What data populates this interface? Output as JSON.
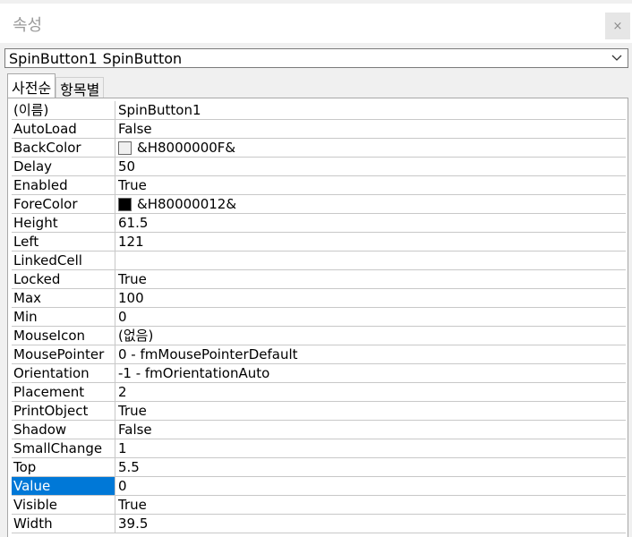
{
  "window": {
    "title": "속성",
    "close_glyph": "×"
  },
  "object_selector": {
    "name": "SpinButton1",
    "type": "SpinButton"
  },
  "tabs": [
    {
      "label": "사전순",
      "active": true
    },
    {
      "label": "항목별",
      "active": false
    }
  ],
  "properties": [
    {
      "name": "(이름)",
      "value": "SpinButton1"
    },
    {
      "name": "AutoLoad",
      "value": "False"
    },
    {
      "name": "BackColor",
      "value": "&H8000000F&",
      "swatch": "#f0f0f0"
    },
    {
      "name": "Delay",
      "value": "50"
    },
    {
      "name": "Enabled",
      "value": "True"
    },
    {
      "name": "ForeColor",
      "value": "&H80000012&",
      "swatch": "#000000"
    },
    {
      "name": "Height",
      "value": "61.5"
    },
    {
      "name": "Left",
      "value": "121"
    },
    {
      "name": "LinkedCell",
      "value": ""
    },
    {
      "name": "Locked",
      "value": "True"
    },
    {
      "name": "Max",
      "value": "100"
    },
    {
      "name": "Min",
      "value": "0"
    },
    {
      "name": "MouseIcon",
      "value": "(없음)"
    },
    {
      "name": "MousePointer",
      "value": "0 - fmMousePointerDefault"
    },
    {
      "name": "Orientation",
      "value": "-1 - fmOrientationAuto"
    },
    {
      "name": "Placement",
      "value": "2"
    },
    {
      "name": "PrintObject",
      "value": "True"
    },
    {
      "name": "Shadow",
      "value": "False"
    },
    {
      "name": "SmallChange",
      "value": "1"
    },
    {
      "name": "Top",
      "value": "5.5"
    },
    {
      "name": "Value",
      "value": "0",
      "selected": true
    },
    {
      "name": "Visible",
      "value": "True"
    },
    {
      "name": "Width",
      "value": "39.5"
    }
  ],
  "colors": {
    "selection": "#0078d7",
    "grid_line": "#c8c8c8"
  }
}
